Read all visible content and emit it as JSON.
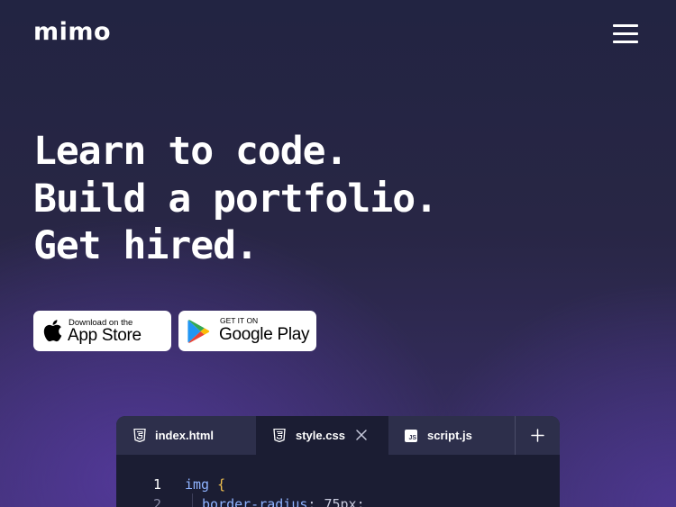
{
  "header": {
    "logo_text": "mimo",
    "menu_icon": "hamburger-menu-icon"
  },
  "hero": {
    "lines": [
      "Learn to code.",
      "Build a portfolio.",
      "Get hired."
    ]
  },
  "store_badges": {
    "apple": {
      "small_text": "Download on the",
      "big_text": "App Store",
      "icon": "apple-logo-icon"
    },
    "google": {
      "small_text": "GET IT ON",
      "big_text": "Google Play",
      "icon": "google-play-logo-icon"
    }
  },
  "editor": {
    "tabs": [
      {
        "label": "index.html",
        "icon": "html5-icon",
        "active": false
      },
      {
        "label": "style.css",
        "icon": "css3-icon",
        "active": true
      },
      {
        "label": "script.js",
        "icon": "js-file-icon",
        "active": false
      }
    ],
    "js_icon_text": "JS",
    "add_tab_icon": "plus-icon",
    "close_icon": "close-icon",
    "code_lines": [
      {
        "number": "1",
        "selector": "img",
        "brace": "{"
      },
      {
        "number": "2",
        "property": "border-radius",
        "punct": ":",
        "value": "75px;"
      }
    ]
  },
  "colors": {
    "background_top": "#222442",
    "background_glow": "#563aa0",
    "editor_bg": "#1b1d33",
    "tabbar_bg": "#2d2f4b",
    "keyword_blue": "#8fb3ff",
    "brace_yellow": "#f2c14e"
  }
}
